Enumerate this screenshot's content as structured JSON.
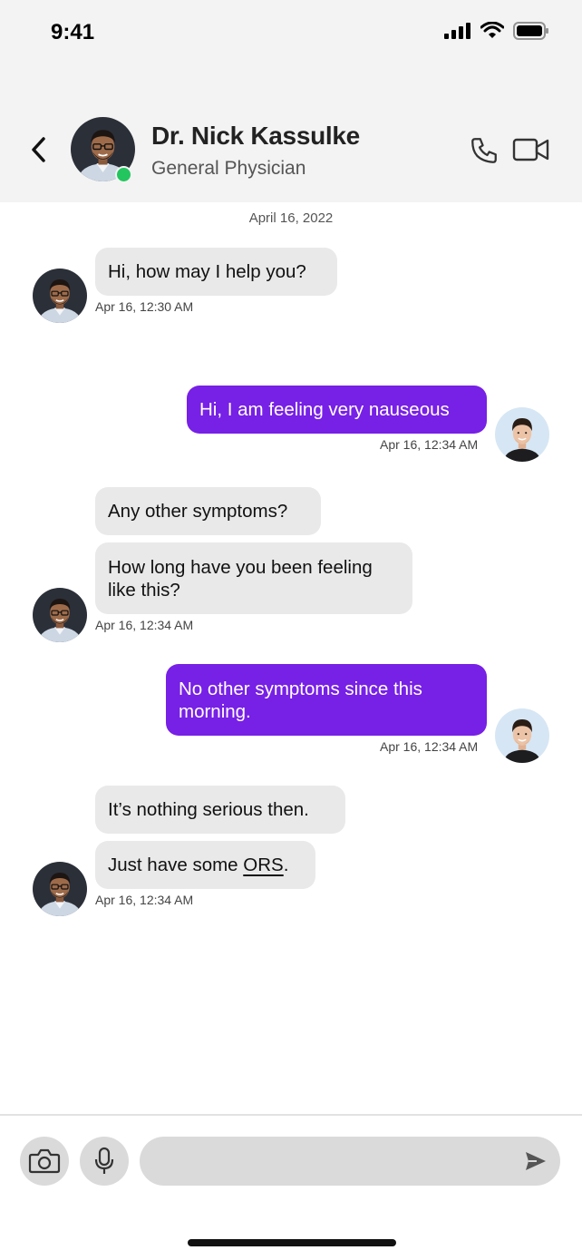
{
  "status_bar": {
    "time": "9:41"
  },
  "header": {
    "name": "Dr. Nick Kassulke",
    "role": "General Physician"
  },
  "chat": {
    "date": "April 16, 2022",
    "messages": [
      {
        "sender": "doctor",
        "text": "Hi, how may I help you?",
        "time": "Apr 16, 12:30 AM"
      },
      {
        "sender": "user",
        "text": "Hi, I am feeling very nauseous",
        "time": "Apr 16, 12:34 AM"
      },
      {
        "sender": "doctor",
        "text": "Any other symptoms?"
      },
      {
        "sender": "doctor",
        "text_line1": "How long have you been feeling",
        "text_line2": "like this?",
        "time": "Apr 16, 12:34 AM"
      },
      {
        "sender": "user",
        "text_line1": "No other symptoms since this",
        "text_line2": "morning.",
        "time": "Apr 16, 12:34 AM"
      },
      {
        "sender": "doctor",
        "text": "It’s nothing serious then."
      },
      {
        "sender": "doctor",
        "text_before": "Just have some ",
        "link": "ORS",
        "text_after": ".",
        "time": "Apr 16, 12:34 AM"
      }
    ]
  },
  "composer": {
    "input_value": "",
    "icons": [
      "camera-icon",
      "microphone-icon",
      "send-icon"
    ]
  },
  "colors": {
    "accent": "#7720e6",
    "incoming_bubble": "#e9e9e9",
    "online": "#22c55e",
    "header_bg": "#f3f3f3"
  }
}
